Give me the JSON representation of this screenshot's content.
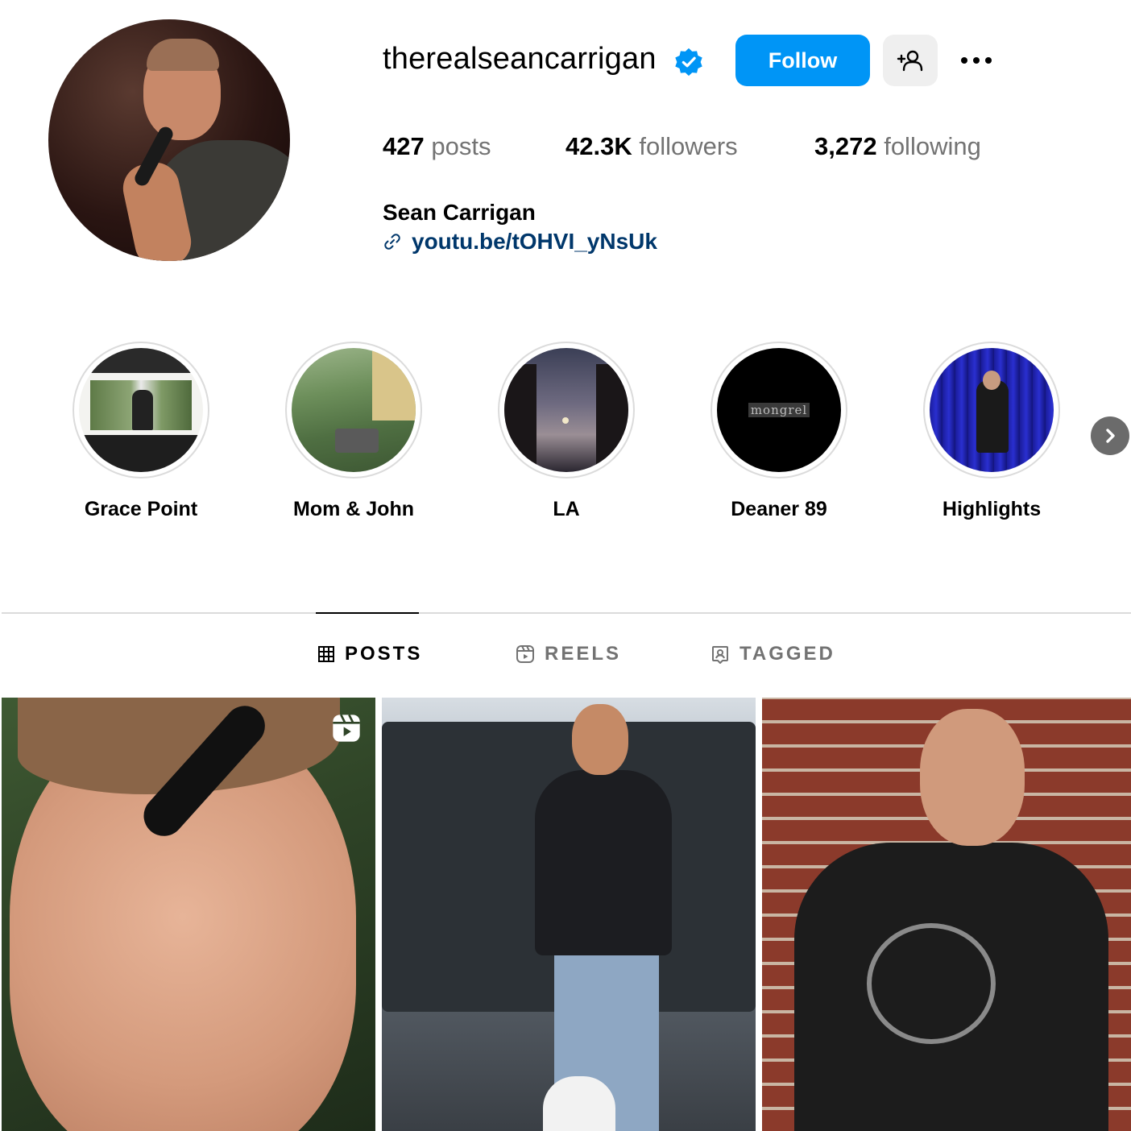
{
  "profile": {
    "username": "therealseancarrigan",
    "verified_icon": "verified-badge-icon",
    "follow_label": "Follow",
    "add_user_icon": "person-add-icon",
    "more_icon": "ellipsis-icon",
    "full_name": "Sean Carrigan",
    "link_icon": "link-icon",
    "link": "youtu.be/tOHVI_yNsUk"
  },
  "stats": {
    "posts_count": "427",
    "posts_label": "posts",
    "followers_count": "42.3K",
    "followers_label": "followers",
    "following_count": "3,272",
    "following_label": "following"
  },
  "highlights": [
    {
      "label": "Grace Point"
    },
    {
      "label": "Mom & John"
    },
    {
      "label": "LA"
    },
    {
      "label": "Deaner 89",
      "thumb_text": "mongrel"
    },
    {
      "label": "Highlights"
    }
  ],
  "highlights_next_icon": "chevron-right-icon",
  "tabs": [
    {
      "label": "POSTS",
      "icon": "grid-icon",
      "active": true
    },
    {
      "label": "REELS",
      "icon": "reels-icon",
      "active": false
    },
    {
      "label": "TAGGED",
      "icon": "tagged-icon",
      "active": false
    }
  ],
  "posts": [
    {
      "type": "reel",
      "badge_icon": "reel-badge-icon"
    },
    {
      "type": "photo"
    },
    {
      "type": "photo"
    }
  ],
  "colors": {
    "accent": "#0095f6",
    "link": "#00376b",
    "muted": "#737373",
    "divider": "#dbdbdb"
  }
}
